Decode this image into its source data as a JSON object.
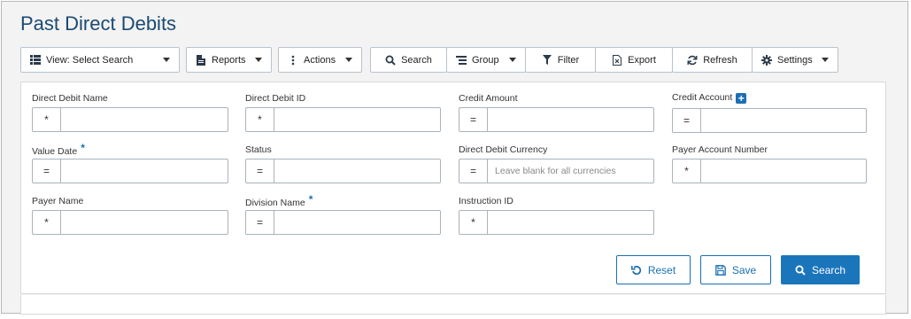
{
  "page": {
    "title": "Past Direct Debits"
  },
  "toolbar": {
    "view_label": "View: Select Search",
    "reports_label": "Reports",
    "actions_label": "Actions",
    "search_label": "Search",
    "group_label": "Group",
    "filter_label": "Filter",
    "export_label": "Export",
    "refresh_label": "Refresh",
    "settings_label": "Settings"
  },
  "form": {
    "direct_debit_name": {
      "label": "Direct Debit Name",
      "operator": "*",
      "value": ""
    },
    "direct_debit_id": {
      "label": "Direct Debit ID",
      "operator": "*",
      "value": ""
    },
    "credit_amount": {
      "label": "Credit Amount",
      "operator": "=",
      "value": ""
    },
    "credit_account": {
      "label": "Credit Account",
      "operator": "=",
      "value": ""
    },
    "value_date": {
      "label": "Value Date",
      "required_mark": "*",
      "operator": "=",
      "value": ""
    },
    "status": {
      "label": "Status",
      "operator": "=",
      "value": ""
    },
    "direct_debit_currency": {
      "label": "Direct Debit Currency",
      "operator": "=",
      "value": "",
      "placeholder": "Leave blank for all currencies"
    },
    "payer_account_number": {
      "label": "Payer Account Number",
      "operator": "*",
      "value": ""
    },
    "payer_name": {
      "label": "Payer Name",
      "operator": "*",
      "value": ""
    },
    "division_name": {
      "label": "Division Name",
      "required_mark": "*",
      "operator": "=",
      "value": ""
    },
    "instruction_id": {
      "label": "Instruction ID",
      "operator": "*",
      "value": ""
    }
  },
  "buttons": {
    "reset_label": "Reset",
    "save_label": "Save",
    "search_label": "Search"
  },
  "colors": {
    "title": "#1a4a72",
    "accent": "#1b75bb"
  }
}
